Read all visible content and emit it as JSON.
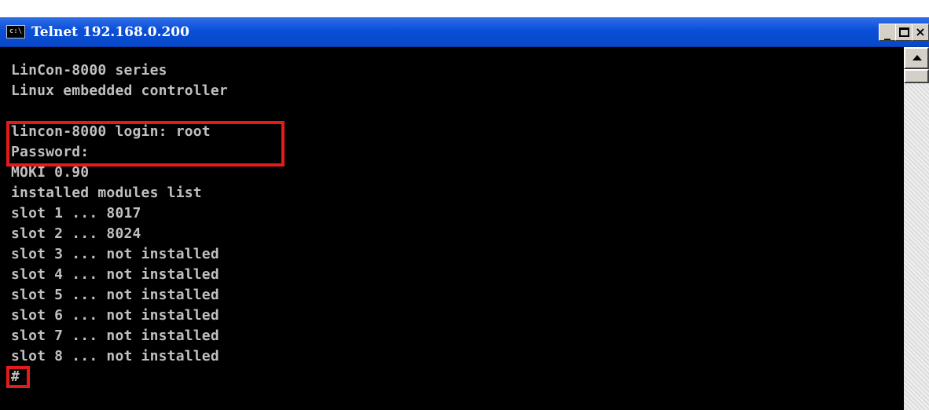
{
  "window": {
    "title": "Telnet 192.168.0.200",
    "icon_text": "c:\\",
    "buttons": {
      "minimize": "_",
      "maximize": "",
      "close": "×"
    }
  },
  "console": {
    "lines": [
      "LinCon-8000 series",
      "Linux embedded controller",
      "",
      "lincon-8000 login: root",
      "Password:",
      "MOKI 0.90",
      "installed modules list",
      "slot 1 ... 8017",
      "slot 2 ... 8024",
      "slot 3 ... not installed",
      "slot 4 ... not installed",
      "slot 5 ... not installed",
      "slot 6 ... not installed",
      "slot 7 ... not installed",
      "slot 8 ... not installed",
      "#"
    ]
  },
  "colors": {
    "titlebar": "#0a4fd8",
    "console_background": "#000000",
    "console_text": "#c0c0c0",
    "highlight": "#e51b1b"
  },
  "icons": [
    "console-icon",
    "minimize-icon",
    "maximize-icon",
    "close-icon",
    "scroll-up-arrow-icon"
  ]
}
